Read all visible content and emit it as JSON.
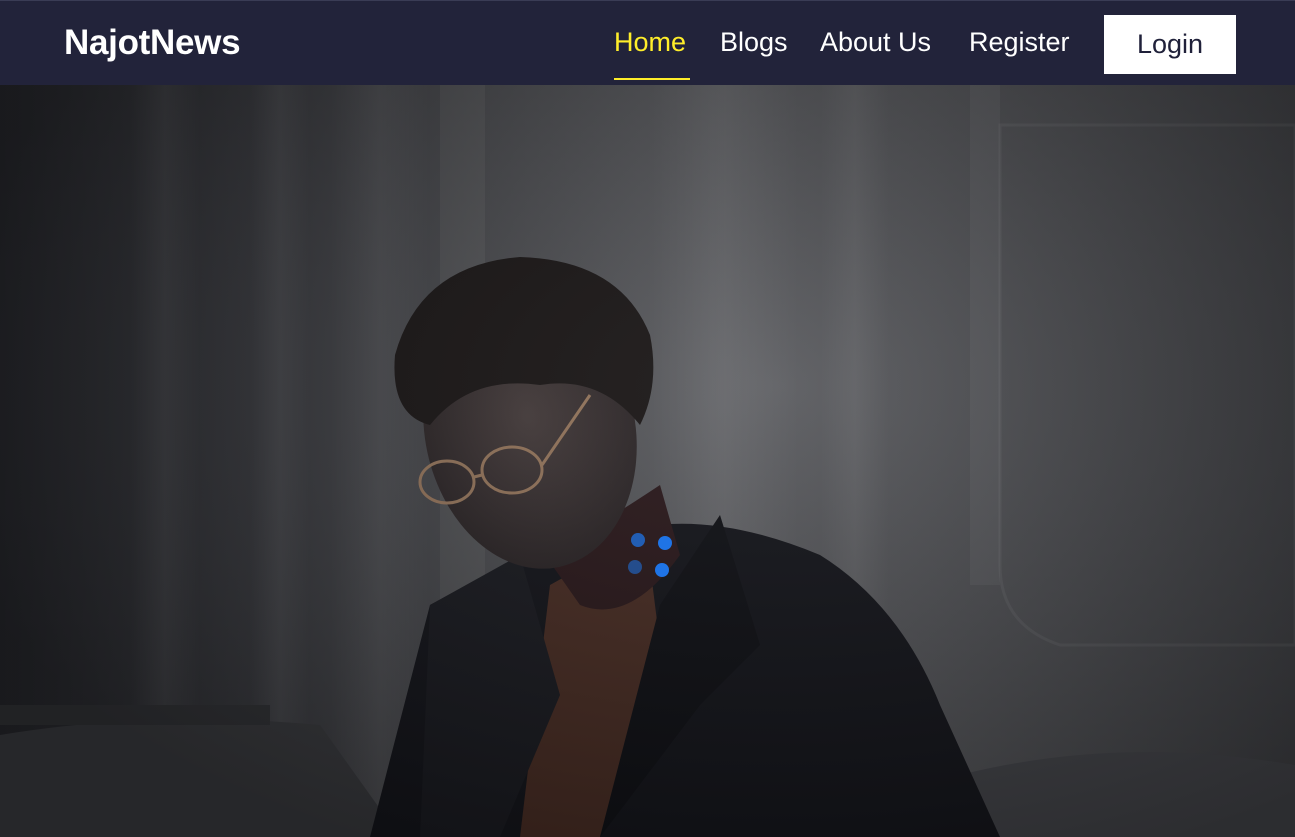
{
  "brand": {
    "name": "NajotNews"
  },
  "nav": {
    "links": [
      {
        "label": "Home",
        "active": true
      },
      {
        "label": "Blogs",
        "active": false
      },
      {
        "label": "About Us",
        "active": false
      },
      {
        "label": "Register",
        "active": false
      }
    ],
    "login_label": "Login"
  },
  "hero": {
    "image": "man-in-glasses-photo",
    "loading_indicator": "spinner-icon"
  },
  "colors": {
    "navbar_bg": "#22233a",
    "active_link": "#ffee2a",
    "link": "#ffffff",
    "login_bg": "#ffffff",
    "login_text": "#20213a",
    "spinner": "#1f74e6"
  }
}
